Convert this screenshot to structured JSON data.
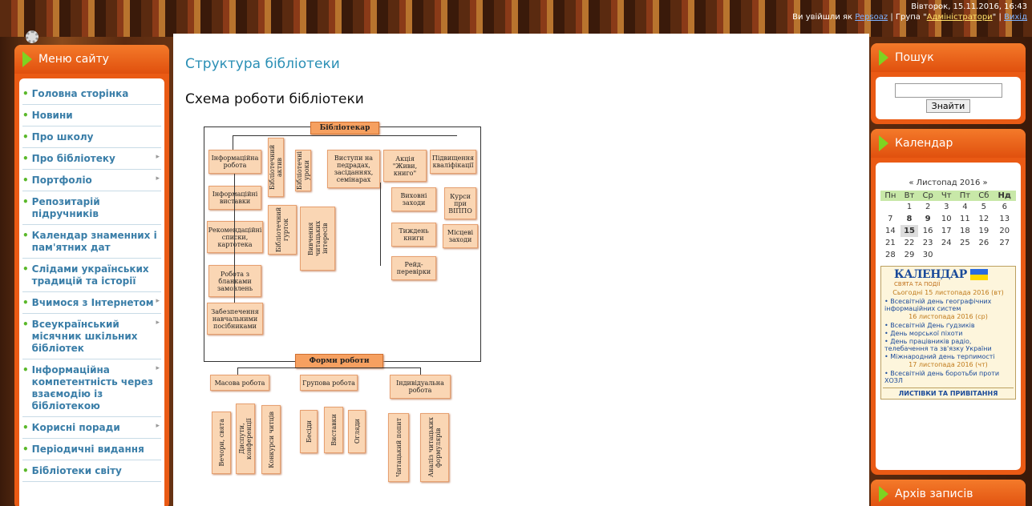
{
  "top": {
    "date": "Вівторок, 15.11.2016, 16:43",
    "logged_prefix": "Ви увійшли як",
    "user": "Pepsoaz",
    "group_prefix": "| Група \"",
    "group": "Адміністратори",
    "group_suffix": "\" |",
    "exit": "Вихід"
  },
  "left_menu": {
    "title": "Меню сайту",
    "items": [
      {
        "label": "Головна сторінка",
        "sub": false
      },
      {
        "label": "Новини",
        "sub": false
      },
      {
        "label": "Про школу",
        "sub": false
      },
      {
        "label": "Про бібліотеку",
        "sub": true
      },
      {
        "label": "Портфоліо",
        "sub": true
      },
      {
        "label": "Репозитарій підручників",
        "sub": false
      },
      {
        "label": "Календар знаменних і пам'ятних дат",
        "sub": false
      },
      {
        "label": "Слідами українських традицій та історії",
        "sub": false
      },
      {
        "label": "Вчимося з Інтернетом",
        "sub": true
      },
      {
        "label": "Всеукраїнський місячник шкільних бібліотек",
        "sub": true
      },
      {
        "label": "Інформаційна компетентність через взаємодію із бібліотекою",
        "sub": true
      },
      {
        "label": "Корисні поради",
        "sub": true
      },
      {
        "label": "Періодичні видання",
        "sub": false
      },
      {
        "label": "Бібліотеки світу",
        "sub": false
      }
    ]
  },
  "main": {
    "page_title": "Структура бібліотеки",
    "subtitle": "Схема роботи бібліотеки",
    "diagram": {
      "root": "Бібліотекар",
      "info_work": "Інформаційна робота",
      "info_exhib": "Інформаційні виставки",
      "recommend": "Рекомендаційні списки, картотека",
      "orders": "Робота з бланками замовлень",
      "supply": "Забезпечення навчальними посібниками",
      "asset": "Бібліотечний актив",
      "circle": "Бібліотечний гурток",
      "lessons": "Бібліотечні уроки",
      "interests": "Вивчення читацьких інтересів",
      "speeches": "Виступи на педрадах, засіданнях, семінарах",
      "action": "Акція \"Живи, книго\"",
      "edu": "Виховні заходи",
      "week": "Тиждень книги",
      "raid": "Рейд-перевірки",
      "qual": "Підвищення кваліфікації",
      "courses": "Курси при ВІППО",
      "local": "Місцеві заходи",
      "forms": "Форми роботи",
      "mass": "Масова робота",
      "group": "Групова робота",
      "indiv": "Індивідуальна робота",
      "evenings": "Вечори, свята",
      "debates": "Диспути, конференції",
      "contests": "Конкурси читців",
      "talks": "Бесіди",
      "exhibits": "Виставки",
      "reviews": "Огляди",
      "poll": "Читацький попит",
      "analysis": "Аналіз читацьких формулярів"
    }
  },
  "search": {
    "title": "Пошук",
    "button": "Знайти",
    "value": ""
  },
  "calendar": {
    "title": "Календар",
    "prev": "«",
    "month": "Листопад 2016",
    "next": "»",
    "days": [
      "Пн",
      "Вт",
      "Ср",
      "Чт",
      "Пт",
      "Сб",
      "Нд"
    ],
    "weeks": [
      [
        "",
        "1",
        "2",
        "3",
        "4",
        "5",
        "6"
      ],
      [
        "7",
        "8",
        "9",
        "10",
        "11",
        "12",
        "13"
      ],
      [
        "14",
        "15",
        "16",
        "17",
        "18",
        "19",
        "20"
      ],
      [
        "21",
        "22",
        "23",
        "24",
        "25",
        "26",
        "27"
      ],
      [
        "28",
        "29",
        "30",
        "",
        "",
        "",
        ""
      ]
    ],
    "widget": {
      "title": "КАЛЕНДАР",
      "sub": "СВЯТА ТА ПОДІЇ",
      "today": "Сьогодні 15 листопада 2016 (вт)",
      "e1": "• Всесвітній день географічних інформаційних систем",
      "d2": "16 листопада 2016 (ср)",
      "e2": "• Всесвітній День ґудзиків",
      "e3": "• День морської піхоти",
      "e4": "• День працівників радіо, телебачення та зв'язку України",
      "e5": "• Міжнародний день терпимості",
      "d3": "17 листопада 2016 (чт)",
      "e6": "• Всесвітній день боротьби проти ХОЗЛ",
      "footer": "ЛИСТІВКИ ТА ПРИВІТАННЯ"
    }
  },
  "archive": {
    "title": "Архів записів"
  }
}
